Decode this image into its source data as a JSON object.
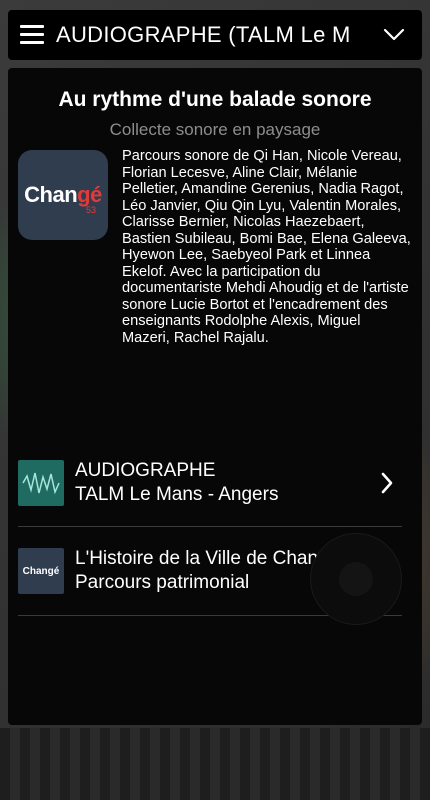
{
  "header": {
    "title": "AUDIOGRAPHE (TALM Le M"
  },
  "card": {
    "title": "Au rythme d'une balade sonore",
    "subtitle": "Collecte sonore en paysage",
    "logo_text_a": "Chan",
    "logo_text_b": "gé",
    "logo_num": "53",
    "description": "Parcours sonore de Qi Han, Nicole Vereau, Florian Lecesve, Aline Clair, Mélanie Pelletier, Amandine Gerenius, Nadia Ragot, Léo Janvier, Qiu Qin Lyu, Valentin Morales, Clarisse Bernier, Nicolas Haezebaert, Bastien Subileau, Bomi Bae, Elena Galeeva, Hyewon Lee, Saebyeol Park et Linnea Ekelof. Avec la participation du documentariste Mehdi Ahoudig et de l'artiste sonore Lucie Bortot et l'encadrement des enseignants Rodolphe Alexis, Miguel Mazeri, Rachel Rajalu."
  },
  "list": [
    {
      "line1": "AUDIOGRAPHE",
      "line2": "TALM Le Mans - Angers"
    },
    {
      "line1": "L'Histoire de la Ville de Changé",
      "line2": "Parcours patrimonial",
      "thumb_text": "Changé"
    }
  ],
  "colors": {
    "card_bg": "#070707",
    "logo_bg": "#2f3d4f",
    "logo_accent": "#e23a3a",
    "audio_thumb_bg": "#1f6b62"
  },
  "icons": {
    "menu": "hamburger-icon",
    "dropdown": "chevron-down-icon",
    "item_arrow": "chevron-right-icon"
  }
}
